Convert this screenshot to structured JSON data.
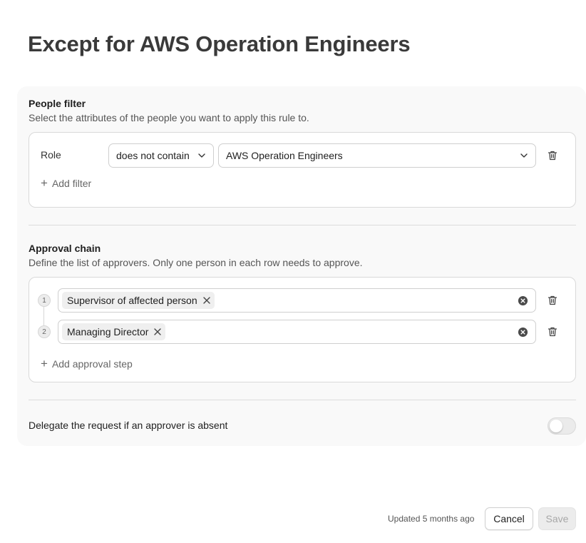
{
  "page": {
    "title": "Except for AWS Operation Engineers"
  },
  "people_filter": {
    "title": "People filter",
    "description": "Select the attributes of the people you want to apply this rule to.",
    "filter": {
      "attribute": "Role",
      "operator": "does not contain",
      "value": "AWS Operation Engineers"
    },
    "add_label": "Add filter"
  },
  "approval_chain": {
    "title": "Approval chain",
    "description": "Define the list of approvers. Only one person in each row needs to approve.",
    "steps": [
      {
        "number": "1",
        "approver": "Supervisor of affected person"
      },
      {
        "number": "2",
        "approver": "Managing Director"
      }
    ],
    "add_label": "Add approval step"
  },
  "delegate": {
    "label": "Delegate the request if an approver is absent",
    "enabled": false
  },
  "footer": {
    "status": "Updated 5 months ago",
    "cancel_label": "Cancel",
    "save_label": "Save"
  },
  "icons": {
    "chevron": "chevron-down-icon",
    "trash": "trash-icon",
    "plus": "plus-icon",
    "remove": "close-icon",
    "clear": "clear-circle-icon"
  },
  "colors": {
    "panel": "#f9f9f9",
    "border": "#d9d9d9",
    "save_disabled_bg": "#ececec"
  }
}
